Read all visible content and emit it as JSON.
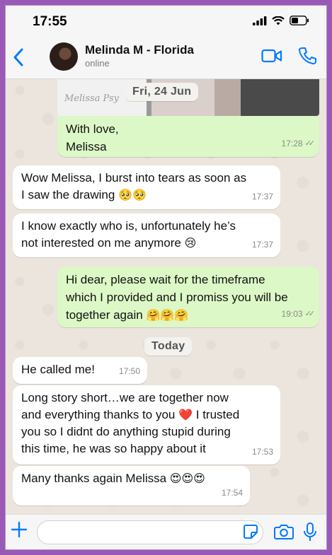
{
  "status_bar": {
    "time": "17:55"
  },
  "header": {
    "contact_name": "Melinda M - Florida",
    "contact_status": "online"
  },
  "image_message": {
    "watermark": "Melissa Psy",
    "date_label": "Fri, 24 Jun"
  },
  "messages": [
    {
      "direction": "out",
      "lines": [
        "With love,",
        "Melissa"
      ],
      "time": "17:28",
      "ticks": "✓✓"
    },
    {
      "direction": "in",
      "lines": [
        "Wow  Melissa, I burst into tears as soon as",
        "I saw the drawing"
      ],
      "emoji": "🥺🥺",
      "time": "17:37"
    },
    {
      "direction": "in",
      "lines": [
        "I know exactly who is, unfortunately he’s",
        "not interested on me anymore"
      ],
      "emoji": "😢",
      "time": "17:37"
    },
    {
      "direction": "out",
      "lines": [
        "Hi dear, please wait for the timeframe",
        "which I provided and I promiss you will be",
        "together again"
      ],
      "emoji": "🤗🤗🤗",
      "time": "19:03",
      "ticks": "✓✓"
    },
    {
      "direction": "in",
      "lines": [
        "He called me!"
      ],
      "time": "17:50"
    },
    {
      "direction": "in",
      "lines": [
        "Long story short…we are together now",
        "and everything thanks to you",
        "you so I didnt do anything stupid during",
        "this time, he was so happy about it"
      ],
      "emoji": "❤️",
      "after_emoji": " I trusted",
      "time": "17:53"
    },
    {
      "direction": "in",
      "lines": [
        "Many thanks again Melissa"
      ],
      "emoji": "😍😍😍",
      "time": "17:54"
    }
  ],
  "today_label": "Today",
  "colors": {
    "accent": "#007aff",
    "incoming": "#ffffff",
    "outgoing": "#dcf8c6",
    "chat_bg": "#ece5dd",
    "frame": "#9b59b6"
  },
  "icons": [
    "back-chevron-icon",
    "video-call-icon",
    "phone-call-icon",
    "plus-icon",
    "sticker-icon",
    "camera-icon",
    "mic-icon",
    "signal-icon",
    "wifi-icon",
    "battery-icon"
  ]
}
